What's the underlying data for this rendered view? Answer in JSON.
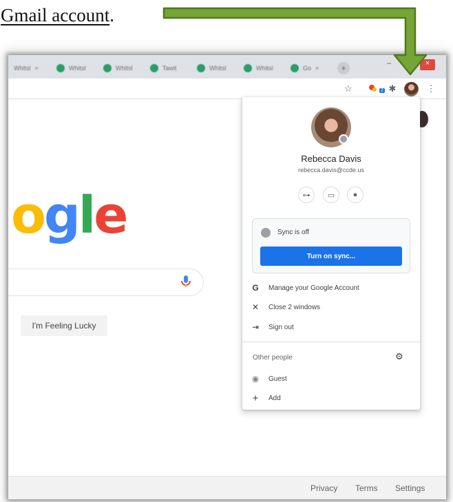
{
  "caption": {
    "text": "Gmail account",
    "punct": "."
  },
  "tabs": [
    {
      "label": "Whitsl"
    },
    {
      "label": "Whitsl"
    },
    {
      "label": "Whitsl"
    },
    {
      "label": "Tawit"
    },
    {
      "label": "Whitsl"
    },
    {
      "label": "Whitsl"
    },
    {
      "label": "Go"
    }
  ],
  "window_controls": {
    "minimize": "–",
    "close": "×"
  },
  "toolbar": {
    "star_icon": "☆",
    "extension_badge": "2",
    "puzzle_icon": "✱",
    "menu_icon": "⋮"
  },
  "google": {
    "logo_letters": [
      "o",
      "g",
      "l",
      "e"
    ],
    "lucky_button": "I'm Feeling Lucky"
  },
  "footer": {
    "privacy": "Privacy",
    "terms": "Terms",
    "settings": "Settings"
  },
  "profile": {
    "name": "Rebecca Davis",
    "email": "rebecca.davis@ccde.us",
    "quick_actions": [
      {
        "icon": "key-icon",
        "glyph": "⊶"
      },
      {
        "icon": "card-icon",
        "glyph": "▭"
      },
      {
        "icon": "location-pin-icon",
        "glyph": "●"
      }
    ],
    "sync_status": "Sync is off",
    "sync_button": "Turn on sync...",
    "menu": [
      {
        "icon": "google-g-icon",
        "glyph": "G",
        "label": "Manage your Google Account"
      },
      {
        "icon": "close-icon",
        "glyph": "✕",
        "label": "Close 2 windows"
      },
      {
        "icon": "sign-out-icon",
        "glyph": "⇥",
        "label": "Sign out"
      }
    ],
    "other_people_label": "Other people",
    "other_people": [
      {
        "icon": "person-circle-icon",
        "glyph": "◉",
        "label": "Guest"
      },
      {
        "icon": "plus-icon",
        "glyph": "+",
        "label": "Add"
      }
    ],
    "gear_icon": "⚙"
  },
  "colors": {
    "arrow": "#76a436",
    "arrow_outline": "#4e7a1e",
    "sync_button": "#1a73e8"
  }
}
